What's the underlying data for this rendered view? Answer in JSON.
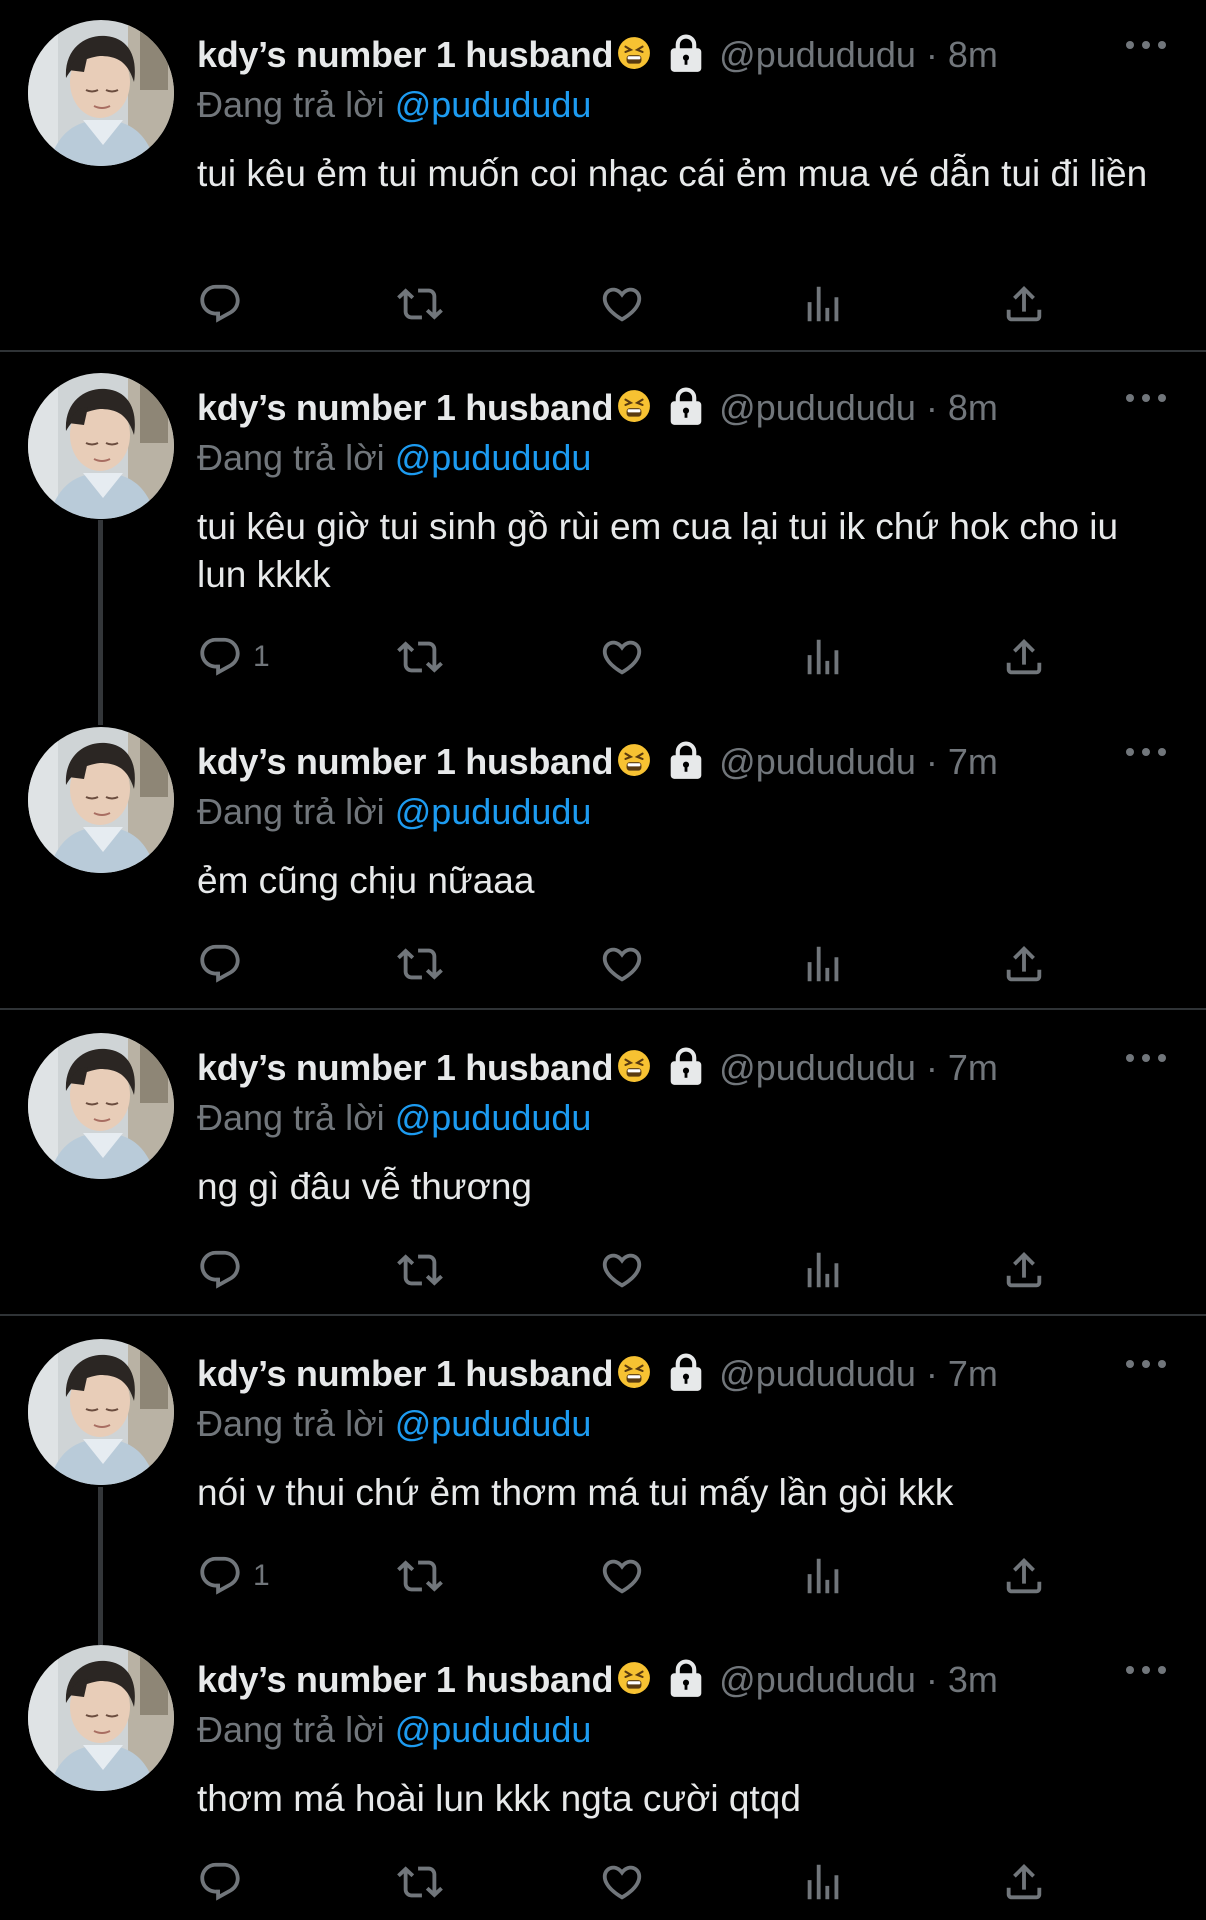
{
  "colors": {
    "background": "#000000",
    "name": "#e7e9ea",
    "muted": "#71767b",
    "link": "#1d9bf0",
    "divider": "#2f3336"
  },
  "tweets": [
    {
      "name": "kdy’s number 1 husband",
      "emoji": "tired-face-emoji",
      "handle": "@pudududu",
      "dot": "·",
      "time": "8m",
      "reply_prefix": "Đang trả lời",
      "reply_handle": "@pudududu",
      "text": "tui kêu ẻm tui muốn coi nhạc cái ẻm mua vé dẫn tui đi liền",
      "reply_count": ""
    },
    {
      "name": "kdy’s number 1 husband",
      "emoji": "tired-face-emoji",
      "handle": "@pudududu",
      "dot": "·",
      "time": "8m",
      "reply_prefix": "Đang trả lời",
      "reply_handle": "@pudududu",
      "text": "tui kêu giờ tui sinh gồ rùi em cua lại tui ik chứ hok cho iu lun kkkk",
      "reply_count": "1"
    },
    {
      "name": "kdy’s number 1 husband",
      "emoji": "tired-face-emoji",
      "handle": "@pudududu",
      "dot": "·",
      "time": "7m",
      "reply_prefix": "Đang trả lời",
      "reply_handle": "@pudududu",
      "text": "ẻm cũng chịu nữaaa",
      "reply_count": ""
    },
    {
      "name": "kdy’s number 1 husband",
      "emoji": "tired-face-emoji",
      "handle": "@pudududu",
      "dot": "·",
      "time": "7m",
      "reply_prefix": "Đang trả lời",
      "reply_handle": "@pudududu",
      "text": "ng gì đâu vễ thương",
      "reply_count": ""
    },
    {
      "name": "kdy’s number 1 husband",
      "emoji": "tired-face-emoji",
      "handle": "@pudududu",
      "dot": "·",
      "time": "7m",
      "reply_prefix": "Đang trả lời",
      "reply_handle": "@pudududu",
      "text": "nói v thui chứ ẻm thơm má tui mấy lần gòi kkk",
      "reply_count": "1"
    },
    {
      "name": "kdy’s number 1 husband",
      "emoji": "tired-face-emoji",
      "handle": "@pudududu",
      "dot": "·",
      "time": "3m",
      "reply_prefix": "Đang trả lời",
      "reply_handle": "@pudududu",
      "text": "thơm má hoài lun kkk ngta cười qtqd",
      "reply_count": ""
    }
  ]
}
